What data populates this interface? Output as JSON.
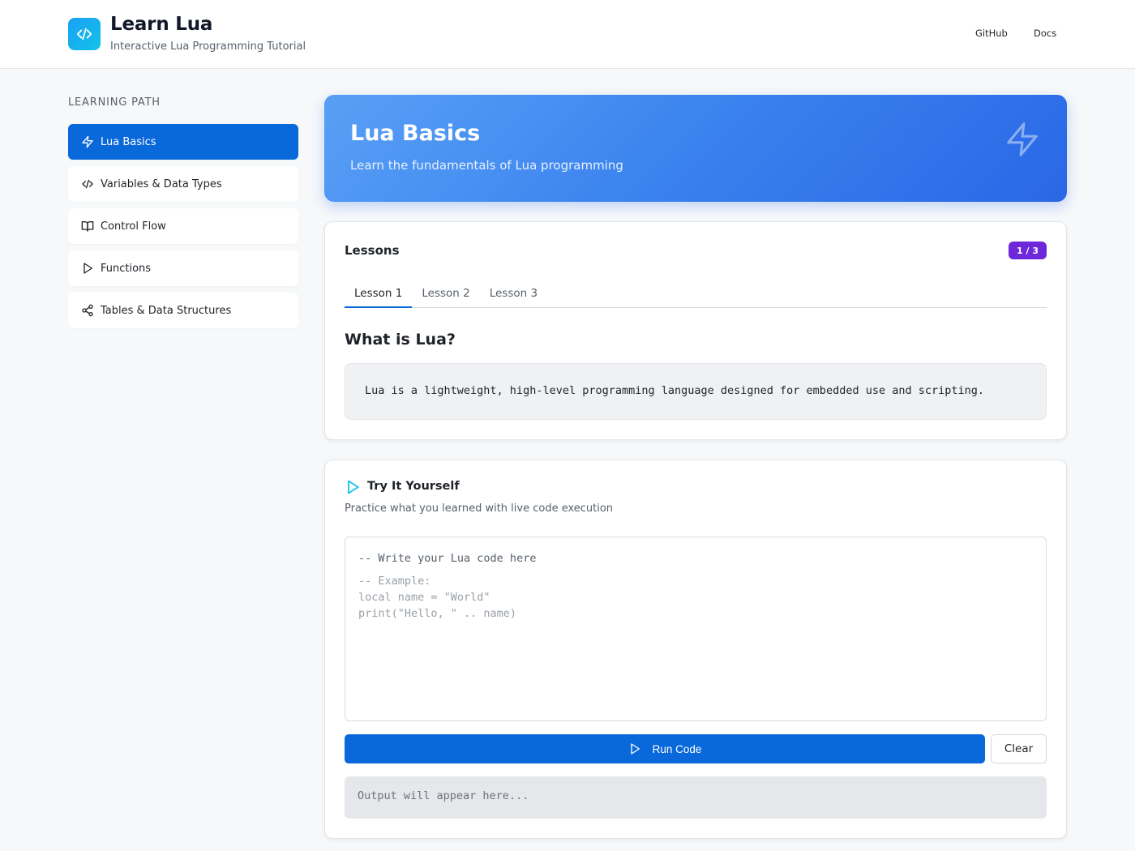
{
  "header": {
    "title": "Learn Lua",
    "subtitle": "Interactive Lua Programming Tutorial",
    "logo_icon": "code-icon",
    "nav": [
      "GitHub",
      "Docs"
    ]
  },
  "sidebar": {
    "heading": "LEARNING PATH",
    "items": [
      {
        "label": "Lua Basics",
        "icon": "lightning-icon",
        "active": true
      },
      {
        "label": "Variables & Data Types",
        "icon": "code-icon",
        "active": false
      },
      {
        "label": "Control Flow",
        "icon": "book-icon",
        "active": false
      },
      {
        "label": "Functions",
        "icon": "play-icon",
        "active": false
      },
      {
        "label": "Tables & Data Structures",
        "icon": "share-icon",
        "active": false
      }
    ]
  },
  "hero": {
    "title": "Lua Basics",
    "subtitle": "Learn the fundamentals of Lua programming",
    "icon": "lightning-icon"
  },
  "lessons": {
    "title": "Lessons",
    "badge": "1 / 3",
    "tabs": [
      "Lesson 1",
      "Lesson 2",
      "Lesson 3"
    ],
    "active_tab": 0,
    "heading": "What is Lua?",
    "content": "Lua is a lightweight, high-level programming language designed for embedded use and scripting."
  },
  "playground": {
    "title": "Try It Yourself",
    "icon": "play-icon",
    "subtitle": "Practice what you learned with live code execution",
    "editor_line": "-- Write your Lua code here",
    "editor_example": "-- Example:\nlocal name = \"World\"\nprint(\"Hello, \" .. name)",
    "run_label": "Run Code",
    "clear_label": "Clear",
    "output_placeholder": "Output will appear here..."
  },
  "colors": {
    "accent": "#0969da",
    "badge": "#6d28d9",
    "logo_gradient_start": "#1aa0f5",
    "logo_gradient_end": "#14c2e8",
    "hero_gradient_start": "#58a0f5",
    "hero_gradient_end": "#2a67e6"
  }
}
